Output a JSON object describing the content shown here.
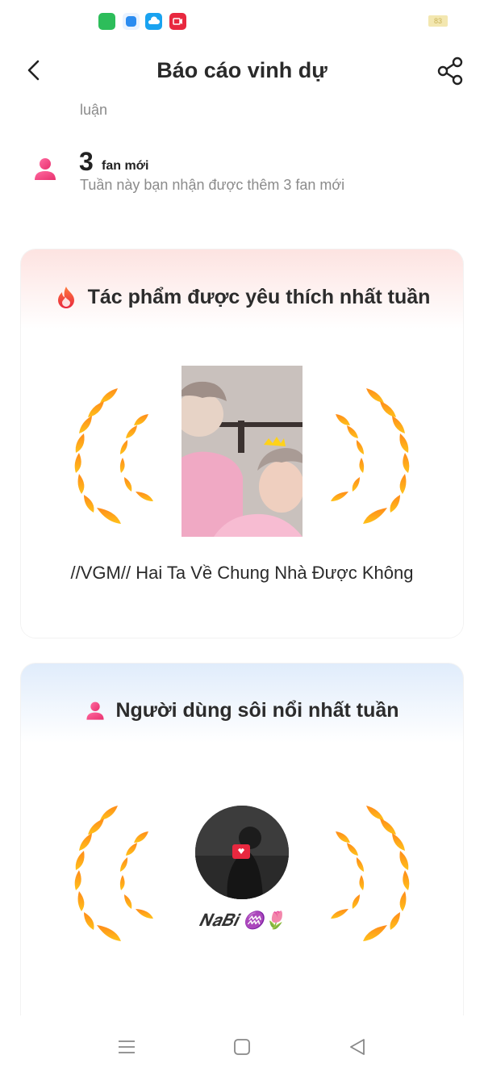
{
  "header": {
    "title": "Báo cáo vinh dự"
  },
  "previous_item": {
    "desc_tail": "luận"
  },
  "fans": {
    "count": "3",
    "label": "fan mới",
    "desc": "Tuần này bạn nhận được thêm 3 fan mới"
  },
  "top_work": {
    "title": "Tác phẩm được yêu thích nhất tuần",
    "work_title": "//VGM// Hai Ta Về Chung Nhà Được Không"
  },
  "top_user": {
    "title": "Người dùng sôi nổi nhất tuần",
    "name": "𝑵𝒂𝑩𝒊 ♒🌷"
  },
  "status_bar": {
    "battery": "83"
  },
  "colors": {
    "accent_pink": "#ff3d7f",
    "laurel_gold": "#ffb21a",
    "laurel_orange": "#ff8a1a"
  }
}
